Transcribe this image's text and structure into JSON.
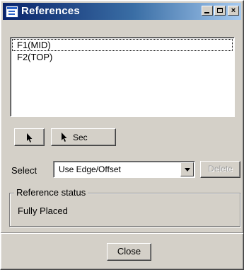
{
  "window": {
    "title": "References",
    "icons": [
      "app-icon",
      "minimize-icon",
      "maximize-icon",
      "close-icon"
    ]
  },
  "references": {
    "items": [
      "F1(MID)",
      "F2(TOP)"
    ],
    "selected_index": 0
  },
  "toolbar": {
    "pick_icon": "arrow-cursor-icon",
    "sec_label": "Sec"
  },
  "select_row": {
    "label": "Select",
    "combo_value": "Use Edge/Offset",
    "delete_label": "Delete"
  },
  "status": {
    "group_title": "Reference status",
    "value": "Fully Placed"
  },
  "footer": {
    "close_label": "Close"
  },
  "colors": {
    "face": "#d4d0c8",
    "title_start": "#0a246a",
    "title_end": "#a6caf0",
    "disabled_text": "#a0a0a0"
  }
}
